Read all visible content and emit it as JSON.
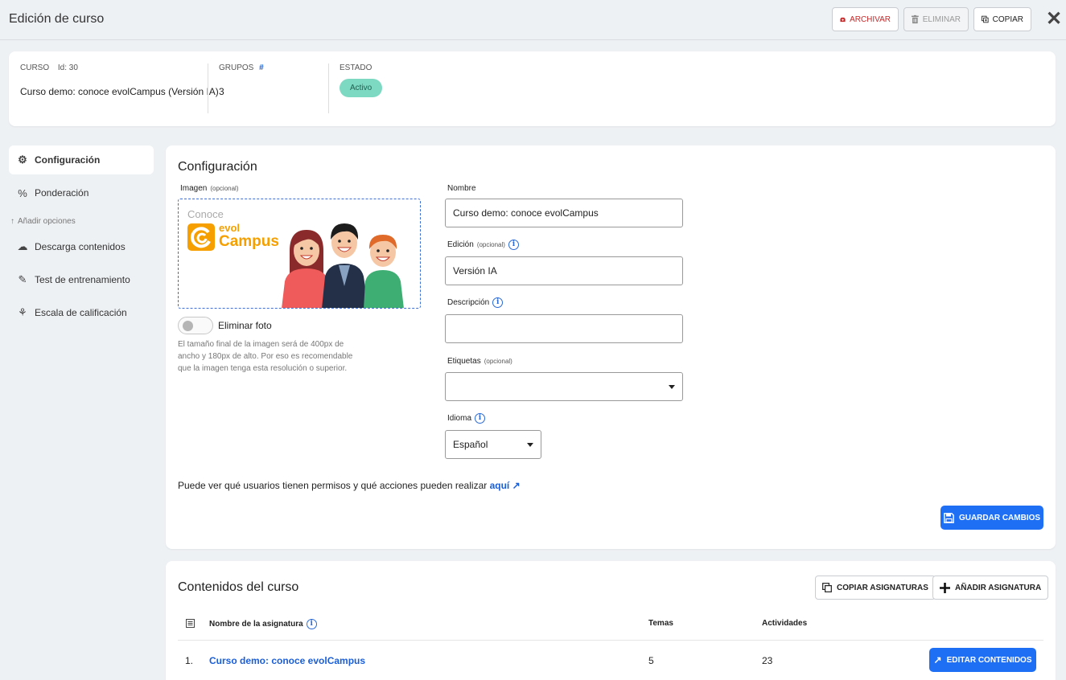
{
  "header": {
    "title": "Edición de curso",
    "archive_label": "ARCHIVAR",
    "delete_label": "ELIMINAR",
    "copy_label": "COPIAR",
    "close_label": "✕"
  },
  "summary": {
    "course_label": "CURSO",
    "course_id": "Id: 30",
    "course_name": "Curso demo: conoce evolCampus (Versión IA)",
    "groups_label": "GRUPOS",
    "groups_icon": "#",
    "groups_count": "3",
    "status_label": "ESTADO",
    "status_value": "Activo"
  },
  "sidebar": {
    "items": [
      {
        "label": "Configuración",
        "icon": "gear-icon",
        "glyph": "⚙"
      },
      {
        "label": "Ponderación",
        "icon": "percent-icon",
        "glyph": "%"
      }
    ],
    "section_label": "Añadir opciones",
    "section_glyph": "↑",
    "options": [
      {
        "label": "Descarga contenidos",
        "icon": "cloud-download-icon",
        "glyph": "☁"
      },
      {
        "label": "Test de entrenamiento",
        "icon": "edit-icon",
        "glyph": "✎"
      },
      {
        "label": "Escala de calificación",
        "icon": "award-icon",
        "glyph": "⚘"
      }
    ]
  },
  "config": {
    "title": "Configuración",
    "image_label": "Imagen",
    "optional": "(opcional)",
    "logo_conoce": "Conoce",
    "logo_evol": "evol",
    "logo_campus": "Campus",
    "remove_photo_label": "Eliminar foto",
    "image_hint": "El tamaño final de la imagen será de 400px de ancho y 180px de alto. Por eso es recomendable que la imagen tenga esta resolución o superior.",
    "name_label": "Nombre",
    "name_value": "Curso demo: conoce evolCampus",
    "edition_label": "Edición",
    "edition_value": "Versión IA",
    "description_label": "Descripción",
    "description_value": "",
    "tags_label": "Etiquetas",
    "tags_value": "",
    "language_label": "Idioma",
    "language_value": "Español",
    "info_glyph": "i",
    "permissions_text": "Puede ver qué usuarios tienen permisos y qué acciones pueden realizar",
    "permissions_link": "aquí",
    "permissions_link_glyph": "↗",
    "save_label": "GUARDAR CAMBIOS"
  },
  "contents": {
    "title": "Contenidos del curso",
    "copy_subjects_label": "COPIAR ASIGNATURAS",
    "add_subject_label": "AÑADIR ASIGNATURA",
    "columns": {
      "name": "Nombre de la asignatura",
      "topics": "Temas",
      "activities": "Actividades"
    },
    "rows": [
      {
        "index": "1.",
        "name": "Curso demo: conoce evolCampus",
        "topics": "5",
        "activities": "23",
        "action": "EDITAR CONTENIDOS"
      }
    ]
  },
  "colors": {
    "accent": "#1f6ff5",
    "archive": "#c62828",
    "status_badge": "#7ed9c3",
    "logo_orange": "#f5a000"
  }
}
